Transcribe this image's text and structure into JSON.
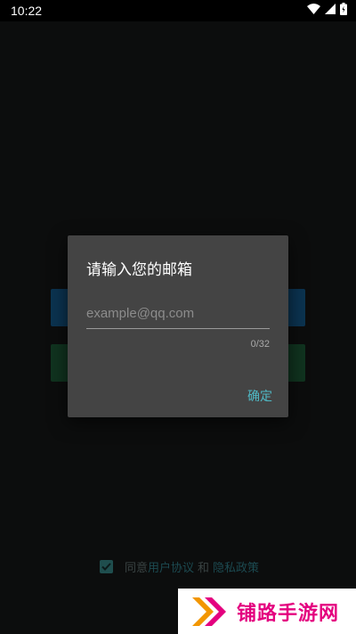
{
  "status_bar": {
    "time": "10:22",
    "icons": [
      "wifi-icon",
      "signal-icon",
      "battery-icon"
    ]
  },
  "background": {
    "agreement": {
      "checked": true,
      "prefix": "同意",
      "user_agreement": "用户协议",
      "conjunction": "和",
      "privacy_policy": "隐私政策"
    }
  },
  "dialog": {
    "title": "请输入您的邮箱",
    "email_input": {
      "value": "",
      "placeholder": "example@qq.com"
    },
    "char_counter": "0/32",
    "confirm_label": "确定"
  },
  "watermark": {
    "text": "铺路手游网"
  },
  "colors": {
    "dialog_background": "#444444",
    "accent": "#4fb8c4",
    "watermark": "#e4007f"
  }
}
